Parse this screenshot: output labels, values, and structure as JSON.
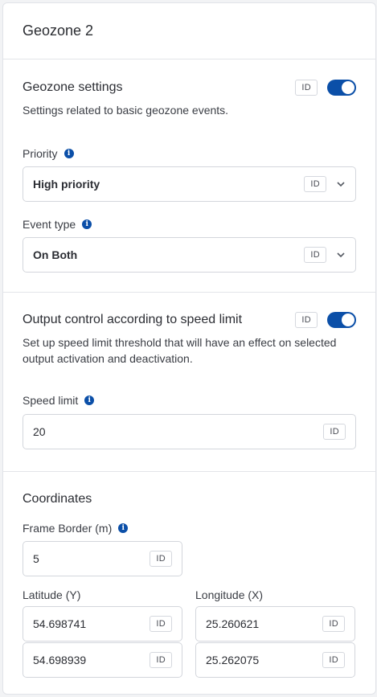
{
  "header": {
    "title": "Geozone 2"
  },
  "geozone_settings": {
    "title": "Geozone settings",
    "id_badge": "ID",
    "enabled": true,
    "description": "Settings related to basic geozone events.",
    "priority": {
      "label": "Priority",
      "value": "High priority",
      "id_badge": "ID"
    },
    "event_type": {
      "label": "Event type",
      "value": "On Both",
      "id_badge": "ID"
    }
  },
  "output_control": {
    "title": "Output control according to speed limit",
    "id_badge": "ID",
    "enabled": true,
    "description": "Set up speed limit threshold that will have an effect on selected output activation and deactivation.",
    "speed_limit": {
      "label": "Speed limit",
      "value": "20",
      "id_badge": "ID"
    }
  },
  "coordinates": {
    "title": "Coordinates",
    "frame_border": {
      "label": "Frame Border (m)",
      "value": "5",
      "id_badge": "ID"
    },
    "latitude": {
      "label": "Latitude (Y)",
      "values": [
        "54.698741",
        "54.698939"
      ],
      "id_badge": "ID"
    },
    "longitude": {
      "label": "Longitude (X)",
      "values": [
        "25.260621",
        "25.262075"
      ],
      "id_badge": "ID"
    }
  },
  "colors": {
    "accent": "#0b4fa8",
    "border": "#d3d6dc"
  }
}
